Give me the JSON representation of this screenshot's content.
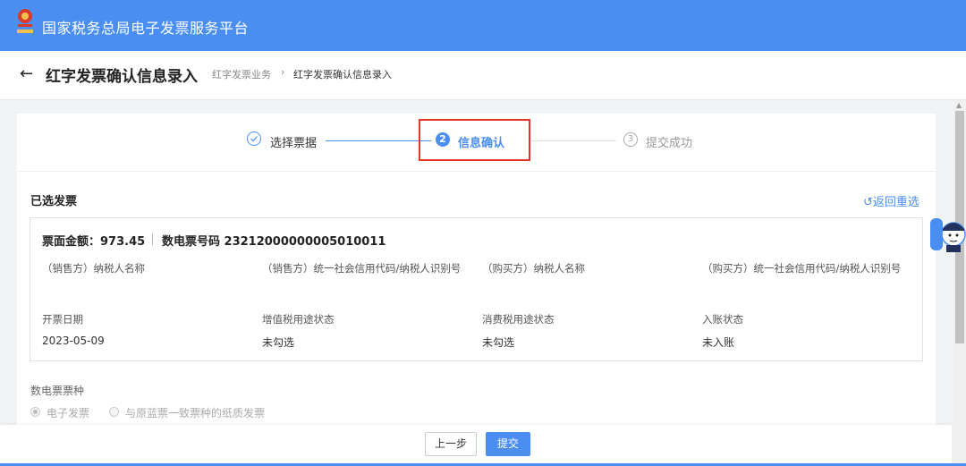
{
  "app": {
    "title": "国家税务总局电子发票服务平台"
  },
  "header": {
    "back_icon": "arrow-left-icon",
    "page_title": "红字发票确认信息录入",
    "breadcrumb": [
      "红字发票业务",
      "红字发票确认信息录入"
    ],
    "breadcrumb_sep": "›"
  },
  "steps": [
    {
      "num": "✓",
      "label": "选择票据",
      "state": "done"
    },
    {
      "num": "2",
      "label": "信息确认",
      "state": "active"
    },
    {
      "num": "3",
      "label": "提交成功",
      "state": "pending"
    }
  ],
  "selected_invoice": {
    "section_title": "已选发票",
    "reselect_label": "↺返回重选",
    "amount_text": "票面金额：973.45",
    "number_text": "数电票号码 23212000000005010011",
    "fields": [
      {
        "label": "（销售方）纳税人名称",
        "value": ""
      },
      {
        "label": "（销售方）统一社会信用代码/纳税人识别号",
        "value": ""
      },
      {
        "label": "（购买方）纳税人名称",
        "value": ""
      },
      {
        "label": "（购买方）统一社会信用代码/纳税人识别号",
        "value": ""
      },
      {
        "label": "开票日期",
        "value": "2023-05-09"
      },
      {
        "label": "增值税用途状态",
        "value": "未勾选"
      },
      {
        "label": "消费税用途状态",
        "value": "未勾选"
      },
      {
        "label": "入账状态",
        "value": "未入账"
      }
    ]
  },
  "invoice_type": {
    "label": "数电票票种",
    "options": [
      {
        "label": "电子发票",
        "selected": true
      },
      {
        "label": "与原蓝票一致票种的纸质发票",
        "selected": false
      }
    ]
  },
  "footer": {
    "prev_label": "上一步",
    "submit_label": "提交"
  },
  "colors": {
    "brand": "#4a8ef2",
    "highlight": "#e8352a"
  }
}
